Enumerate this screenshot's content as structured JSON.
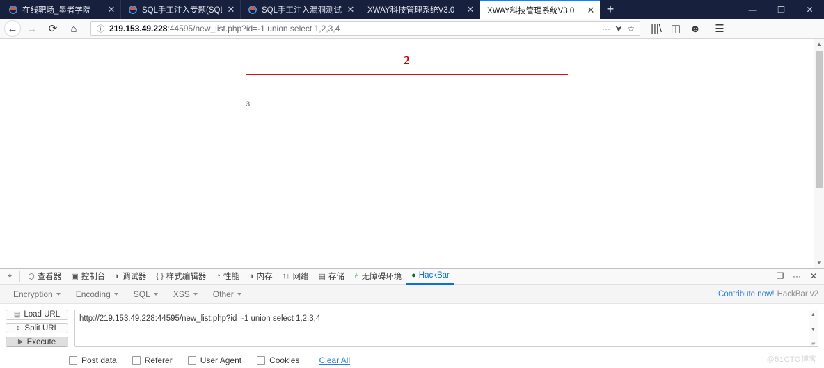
{
  "window": {
    "controls": {
      "minimize": "—",
      "restore": "❐",
      "close": "✕"
    }
  },
  "tabs": [
    {
      "title": "在线靶场_墨者学院",
      "close": "✕",
      "active": false
    },
    {
      "title": "SQL手工注入专题(SQL Injectio",
      "close": "✕",
      "active": false
    },
    {
      "title": "SQL手工注入漏洞测试(MySQL",
      "close": "✕",
      "active": false
    },
    {
      "title": "XWAY科技管理系统V3.0",
      "close": "✕",
      "active": false
    },
    {
      "title": "XWAY科技管理系统V3.0",
      "close": "✕",
      "active": true
    }
  ],
  "newtab_label": "+",
  "nav": {
    "back": "←",
    "forward": "→",
    "reload": "⟳",
    "home": "⌂",
    "url_host": "219.153.49.228",
    "url_rest": ":44595/new_list.php?id=-1 union select 1,2,3,4",
    "identity_icon": "ⓘ",
    "page_actions": "···",
    "pocket": "⮟",
    "bookmark": "☆",
    "library": "|||\\",
    "sidebar": "◫",
    "account": "☻",
    "menu": "☰"
  },
  "page": {
    "value_2": "2",
    "value_3": "3",
    "rule_color": "#d41111",
    "text_color": "#cc0000"
  },
  "devtools": {
    "tools": [
      {
        "icon": "⌖",
        "label": "",
        "name": "picker"
      },
      {
        "icon": "⬡",
        "label": "查看器"
      },
      {
        "icon": "▣",
        "label": "控制台"
      },
      {
        "icon": "◗",
        "label": "调试器"
      },
      {
        "icon": "{ }",
        "label": "样式编辑器"
      },
      {
        "icon": "◔",
        "label": "性能"
      },
      {
        "icon": "◑",
        "label": "内存"
      },
      {
        "icon": "↑↓",
        "label": "网络"
      },
      {
        "icon": "▤",
        "label": "存储"
      },
      {
        "icon": "⑃",
        "label": "无障碍环境"
      },
      {
        "icon": "●",
        "label": "HackBar"
      }
    ],
    "right": {
      "responsive": "❐",
      "more": "···",
      "close": "✕"
    }
  },
  "hackbar": {
    "menus": [
      "Encryption",
      "Encoding",
      "SQL",
      "XSS",
      "Other"
    ],
    "contribute": "Contribute now!",
    "version": "HackBar v2",
    "buttons": [
      {
        "label": "Load URL",
        "icon": "▤"
      },
      {
        "label": "Split URL",
        "icon": "⚱"
      },
      {
        "label": "Execute",
        "icon": "▶"
      }
    ],
    "url_value": "http://219.153.49.228:44595/new_list.php?id=-1 union select 1,2,3,4",
    "options": [
      "Post data",
      "Referer",
      "User Agent",
      "Cookies"
    ],
    "clear_all": "Clear All"
  },
  "watermark": "@51CTO博客"
}
